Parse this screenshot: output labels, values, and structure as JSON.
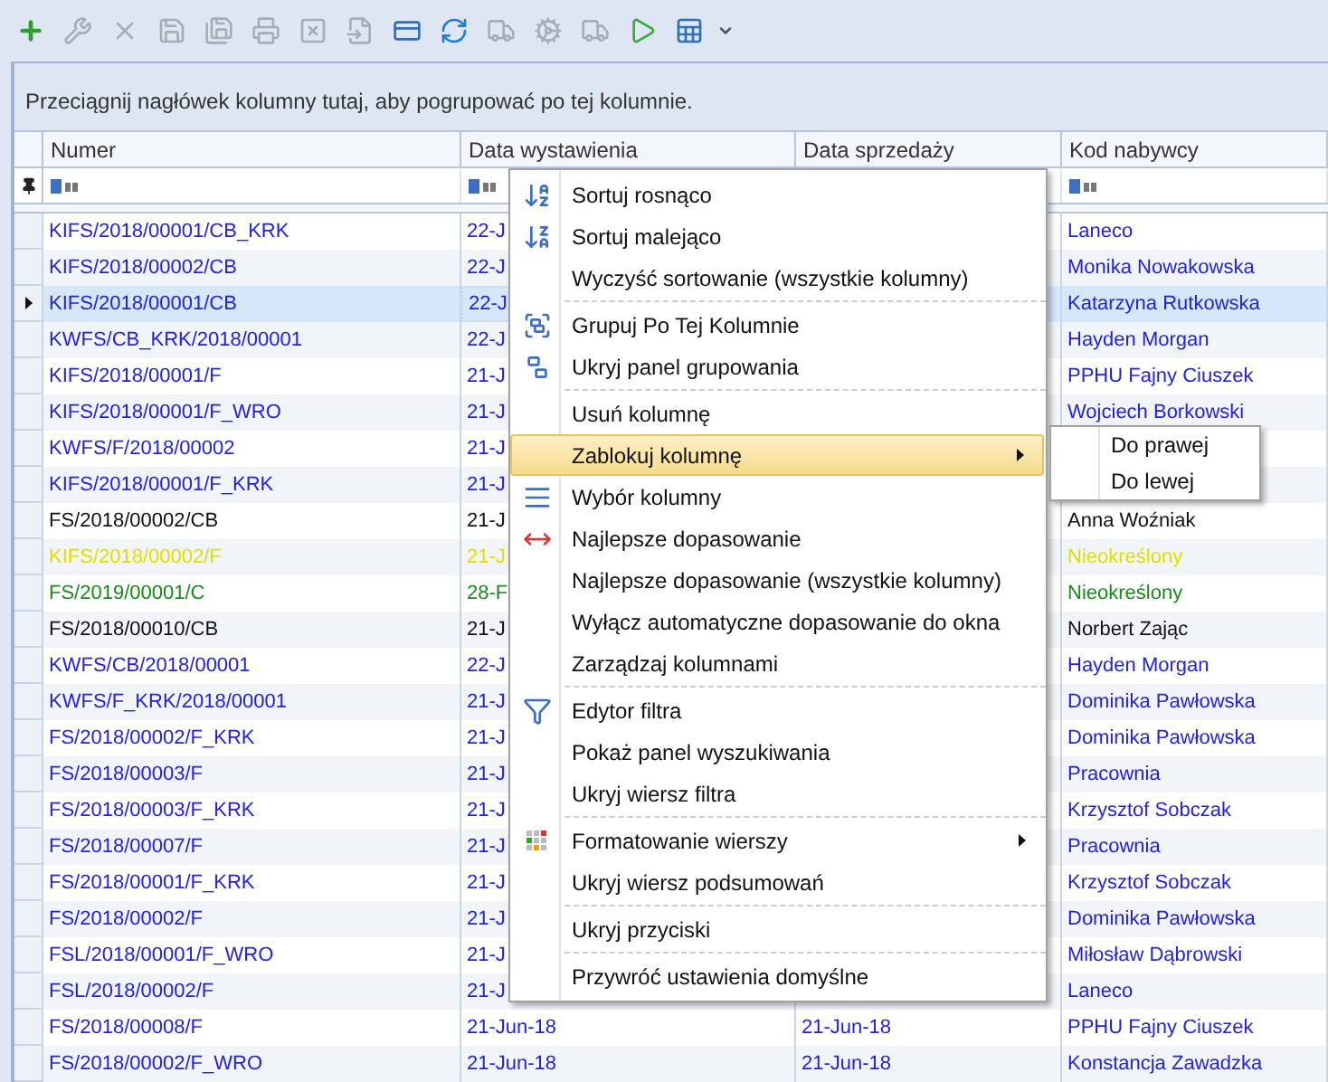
{
  "toolbar": [
    {
      "kind": "add",
      "disabled": false
    },
    {
      "kind": "wrench",
      "disabled": true
    },
    {
      "kind": "delete",
      "disabled": true
    },
    {
      "kind": "save",
      "disabled": true
    },
    {
      "kind": "save-all",
      "disabled": true
    },
    {
      "kind": "print",
      "disabled": true
    },
    {
      "kind": "cancel-doc",
      "disabled": true
    },
    {
      "kind": "doc-arrow",
      "disabled": true
    },
    {
      "kind": "card",
      "disabled": false
    },
    {
      "kind": "refresh",
      "disabled": false
    },
    {
      "kind": "truck-gear",
      "disabled": true
    },
    {
      "kind": "gears",
      "disabled": true
    },
    {
      "kind": "truck",
      "disabled": true
    },
    {
      "kind": "run",
      "disabled": false
    },
    {
      "kind": "export",
      "disabled": false
    }
  ],
  "group_panel": {
    "text": "Przeciągnij nagłówek kolumny tutaj, aby pogrupować po tej kolumnie."
  },
  "table": {
    "columns": [
      "Numer",
      "Data wystawienia",
      "Data sprzedaży",
      "Kod nabywcy"
    ],
    "rows": [
      {
        "cells": [
          "KIFS/2018/00001/CB_KRK",
          "22-J",
          "",
          "Laneco"
        ],
        "color": "#2222dd",
        "selected": false
      },
      {
        "cells": [
          "KIFS/2018/00002/CB",
          "22-J",
          "",
          "Monika Nowakowska"
        ],
        "color": "#2222dd",
        "selected": false
      },
      {
        "cells": [
          "KIFS/2018/00001/CB",
          "22-J",
          "",
          "Katarzyna Rutkowska"
        ],
        "color": "#2222dd",
        "selected": true
      },
      {
        "cells": [
          "KWFS/CB_KRK/2018/00001",
          "22-J",
          "",
          "Hayden Morgan"
        ],
        "color": "#2222dd",
        "selected": false
      },
      {
        "cells": [
          "KIFS/2018/00001/F",
          "21-J",
          "",
          "PPHU Fajny Ciuszek"
        ],
        "color": "#2222dd",
        "selected": false
      },
      {
        "cells": [
          "KIFS/2018/00001/F_WRO",
          "21-J",
          "",
          "Wojciech Borkowski"
        ],
        "color": "#2222dd",
        "selected": false
      },
      {
        "cells": [
          "KWFS/F/2018/00002",
          "21-J",
          "",
          ""
        ],
        "color": "#2222dd",
        "selected": false
      },
      {
        "cells": [
          "KIFS/2018/00001/F_KRK",
          "21-J",
          "",
          ""
        ],
        "color": "#2222dd",
        "selected": false
      },
      {
        "cells": [
          "FS/2018/00002/CB",
          "21-J",
          "",
          "Anna Woźniak"
        ],
        "color": "#111111",
        "selected": false
      },
      {
        "cells": [
          "KIFS/2018/00002/F",
          "21-J",
          "",
          "Nieokreślony"
        ],
        "color": "#e0e000",
        "selected": false
      },
      {
        "cells": [
          "FS/2019/00001/C",
          "28-F",
          "",
          "Nieokreślony"
        ],
        "color": "#1a8a1a",
        "selected": false
      },
      {
        "cells": [
          "FS/2018/00010/CB",
          "21-J",
          "",
          "Norbert Zając"
        ],
        "color": "#111111",
        "selected": false
      },
      {
        "cells": [
          "KWFS/CB/2018/00001",
          "22-J",
          "",
          "Hayden Morgan"
        ],
        "color": "#2222dd",
        "selected": false
      },
      {
        "cells": [
          "KWFS/F_KRK/2018/00001",
          "21-J",
          "",
          "Dominika Pawłowska"
        ],
        "color": "#2222dd",
        "selected": false
      },
      {
        "cells": [
          "FS/2018/00002/F_KRK",
          "21-J",
          "",
          "Dominika Pawłowska"
        ],
        "color": "#2222dd",
        "selected": false
      },
      {
        "cells": [
          "FS/2018/00003/F",
          "21-J",
          "",
          "Pracownia"
        ],
        "color": "#2222dd",
        "selected": false
      },
      {
        "cells": [
          "FS/2018/00003/F_KRK",
          "21-J",
          "",
          "Krzysztof Sobczak"
        ],
        "color": "#2222dd",
        "selected": false
      },
      {
        "cells": [
          "FS/2018/00007/F",
          "21-J",
          "",
          "Pracownia"
        ],
        "color": "#2222dd",
        "selected": false
      },
      {
        "cells": [
          "FS/2018/00001/F_KRK",
          "21-J",
          "",
          "Krzysztof Sobczak"
        ],
        "color": "#2222dd",
        "selected": false
      },
      {
        "cells": [
          "FS/2018/00002/F",
          "21-J",
          "",
          "Dominika Pawłowska"
        ],
        "color": "#2222dd",
        "selected": false
      },
      {
        "cells": [
          "FSL/2018/00001/F_WRO",
          "21-J",
          "",
          "Miłosław Dąbrowski"
        ],
        "color": "#2222dd",
        "selected": false
      },
      {
        "cells": [
          "FSL/2018/00002/F",
          "21-J",
          "",
          "Laneco"
        ],
        "color": "#2222dd",
        "selected": false
      },
      {
        "cells": [
          "FS/2018/00008/F",
          "21-Jun-18",
          "21-Jun-18",
          "PPHU Fajny Ciuszek"
        ],
        "color": "#2222dd",
        "selected": false
      },
      {
        "cells": [
          "FS/2018/00002/F_WRO",
          "21-Jun-18",
          "21-Jun-18",
          "Konstancja Zawadzka"
        ],
        "color": "#2222dd",
        "selected": false
      }
    ]
  },
  "context_menu": {
    "sections": [
      [
        {
          "label": "Sortuj rosnąco",
          "kind": "sort-asc",
          "selected": false,
          "submenu": false
        },
        {
          "label": "Sortuj malejąco",
          "kind": "sort-desc",
          "selected": false,
          "submenu": false
        },
        {
          "label": "Wyczyść sortowanie (wszystkie kolumny)",
          "kind": "plain",
          "selected": false,
          "submenu": false
        }
      ],
      [
        {
          "label": "Grupuj Po Tej Kolumnie",
          "kind": "group",
          "selected": false,
          "submenu": false
        },
        {
          "label": "Ukryj panel grupowania",
          "kind": "hide-group",
          "selected": false,
          "submenu": false
        }
      ],
      [
        {
          "label": "Usuń kolumnę",
          "kind": "plain",
          "selected": false,
          "submenu": false
        },
        {
          "label": "Zablokuj kolumnę",
          "kind": "plain",
          "selected": true,
          "submenu": true
        },
        {
          "label": "Wybór kolumny",
          "kind": "columns",
          "selected": false,
          "submenu": false
        },
        {
          "label": "Najlepsze dopasowanie",
          "kind": "best-fit",
          "selected": false,
          "submenu": false
        },
        {
          "label": "Najlepsze dopasowanie (wszystkie kolumny)",
          "kind": "plain",
          "selected": false,
          "submenu": false
        },
        {
          "label": "Wyłącz automatyczne dopasowanie do okna",
          "kind": "plain",
          "selected": false,
          "submenu": false
        },
        {
          "label": "Zarządzaj kolumnami",
          "kind": "plain",
          "selected": false,
          "submenu": false
        }
      ],
      [
        {
          "label": "Edytor filtra",
          "kind": "filter",
          "selected": false,
          "submenu": false
        },
        {
          "label": "Pokaż panel wyszukiwania",
          "kind": "plain",
          "selected": false,
          "submenu": false
        },
        {
          "label": "Ukryj wiersz filtra",
          "kind": "plain",
          "selected": false,
          "submenu": false
        }
      ],
      [
        {
          "label": "Formatowanie wierszy",
          "kind": "format",
          "selected": false,
          "submenu": true
        },
        {
          "label": "Ukryj wiersz podsumowań",
          "kind": "plain",
          "selected": false,
          "submenu": false
        }
      ],
      [
        {
          "label": "Ukryj przyciski",
          "kind": "plain",
          "selected": false,
          "submenu": false
        }
      ],
      [
        {
          "label": "Przywróć ustawienia domyślne",
          "kind": "plain",
          "selected": false,
          "submenu": false
        }
      ]
    ]
  },
  "submenu": {
    "items": [
      "Do prawej",
      "Do lewej"
    ]
  }
}
